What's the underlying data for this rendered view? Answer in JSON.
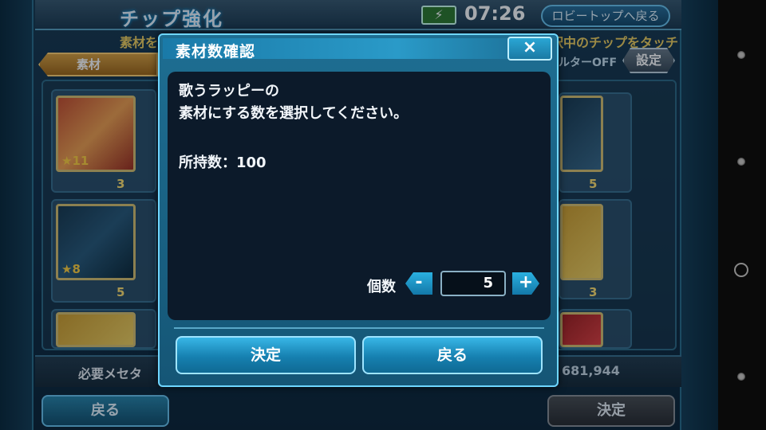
{
  "background": {
    "title": "チップ強化",
    "clock": "07:26",
    "lobby_button": "ロビートップへ戻る",
    "subbar_left": "素材を",
    "subbar_right": "択中のチップをタッチ",
    "tab_material": "素材",
    "filter_label": "ルターOFF",
    "settings_button": "設定",
    "cards": [
      {
        "stars": "★11",
        "count": "3"
      },
      {
        "stars": "★8",
        "count": "5"
      }
    ],
    "right_counts": [
      "5",
      "3"
    ],
    "required_meseta_label": "必要メセタ",
    "meseta_value": "681,944",
    "back_button": "戻る",
    "confirm_button": "決定"
  },
  "dialog": {
    "title": "素材数確認",
    "close_icon": "×",
    "message_line1": "歌うラッピーの",
    "message_line2": "素材にする数を選択してください。",
    "owned_count": "所持数：100",
    "quantity_label": "個数",
    "quantity_value": "5",
    "minus_label": "-",
    "plus_label": "+",
    "confirm_button": "決定",
    "back_button": "戻る"
  },
  "colors": {
    "dialog_frame": "#1e6e92",
    "dialog_body": "#0c1a2a",
    "button_blue": "#1680b0",
    "accent_gold": "#f0d060"
  }
}
